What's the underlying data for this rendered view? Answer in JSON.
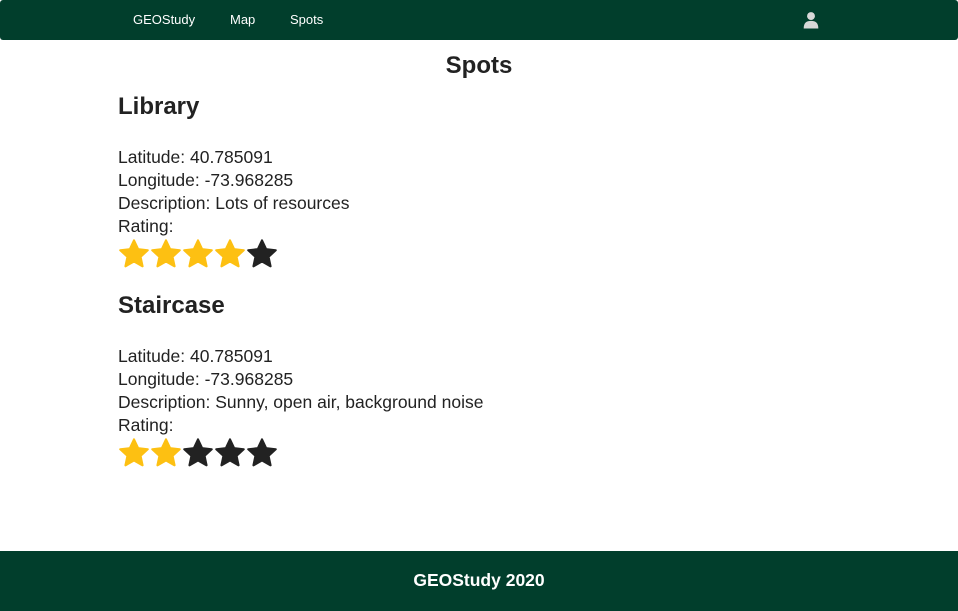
{
  "nav": {
    "brand": "GEOStudy",
    "links": [
      "Map",
      "Spots"
    ],
    "user_icon": "user-icon"
  },
  "page": {
    "title": "Spots"
  },
  "spots": [
    {
      "name": "Library",
      "latitude": "Latitude: 40.785091",
      "longitude": "Longitude: -73.968285",
      "description": "Description: Lots of resources",
      "rating_label": "Rating:",
      "rating": 4,
      "rating_max": 5
    },
    {
      "name": "Staircase",
      "latitude": "Latitude: 40.785091",
      "longitude": "Longitude: -73.968285",
      "description": "Description: Sunny, open air, background noise",
      "rating_label": "Rating:",
      "rating": 2,
      "rating_max": 5
    }
  ],
  "colors": {
    "nav_bg": "#013e2c",
    "star_filled": "#fdc012",
    "star_empty": "#222222",
    "text": "#222222"
  },
  "footer": {
    "text": "GEOStudy 2020"
  }
}
